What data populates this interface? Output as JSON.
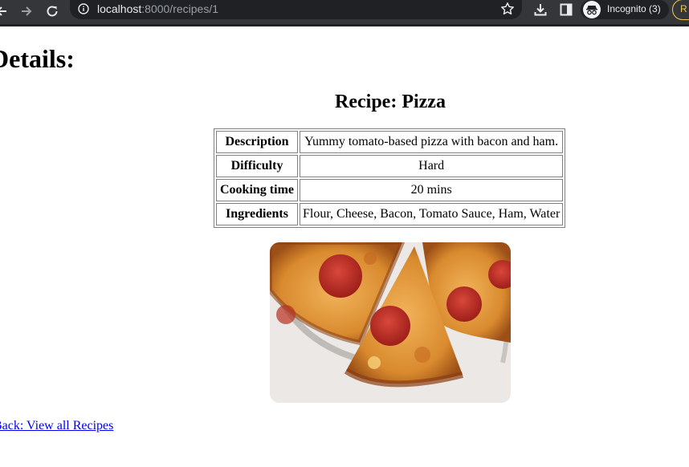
{
  "browser": {
    "url_host": "localhost",
    "url_path": ":8000/recipes/1",
    "incognito_label": "Incognito (3)",
    "relaunch_label": "R",
    "icons": [
      "back-arrow-icon",
      "forward-arrow-icon",
      "reload-icon",
      "info-icon",
      "star-icon",
      "download-icon",
      "side-panel-icon",
      "incognito-icon"
    ]
  },
  "page": {
    "heading": "Details:",
    "recipe_title": "Recipe: Pizza",
    "table": {
      "rows": [
        {
          "label": "Description",
          "value": "Yummy tomato-based pizza with bacon and ham."
        },
        {
          "label": "Difficulty",
          "value": "Hard"
        },
        {
          "label": "Cooking time",
          "value": "20 mins"
        },
        {
          "label": "Ingredients",
          "value": "Flour, Cheese, Bacon, Tomato Sauce, Ham, Water"
        }
      ]
    },
    "back_link": "Back: View all Recipes"
  },
  "colors": {
    "chrome_bg": "#35363a",
    "omnibox_bg": "#202124",
    "link": "#0000ee",
    "relaunch_accent": "#f2c94c"
  }
}
